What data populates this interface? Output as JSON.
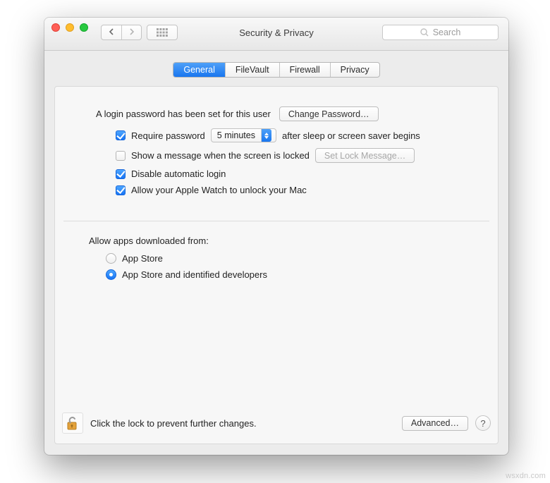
{
  "window": {
    "title": "Security & Privacy"
  },
  "toolbar": {
    "search_placeholder": "Search"
  },
  "tabs": {
    "items": [
      {
        "label": "General",
        "active": true
      },
      {
        "label": "FileVault",
        "active": false
      },
      {
        "label": "Firewall",
        "active": false
      },
      {
        "label": "Privacy",
        "active": false
      }
    ]
  },
  "general": {
    "login_password_text": "A login password has been set for this user",
    "change_password_label": "Change Password…",
    "require_password_label": "Require password",
    "require_password_delay": "5 minutes",
    "require_password_suffix": "after sleep or screen saver begins",
    "show_message_label": "Show a message when the screen is locked",
    "set_lock_message_label": "Set Lock Message…",
    "disable_auto_login_label": "Disable automatic login",
    "apple_watch_label": "Allow your Apple Watch to unlock your Mac",
    "checks": {
      "require_password": true,
      "show_message": false,
      "disable_auto_login": true,
      "apple_watch": true
    }
  },
  "download": {
    "heading": "Allow apps downloaded from:",
    "options": [
      {
        "label": "App Store",
        "selected": false
      },
      {
        "label": "App Store and identified developers",
        "selected": true
      }
    ]
  },
  "footer": {
    "lock_text": "Click the lock to prevent further changes.",
    "advanced_label": "Advanced…",
    "help_label": "?"
  },
  "watermark": "wsxdn.com"
}
